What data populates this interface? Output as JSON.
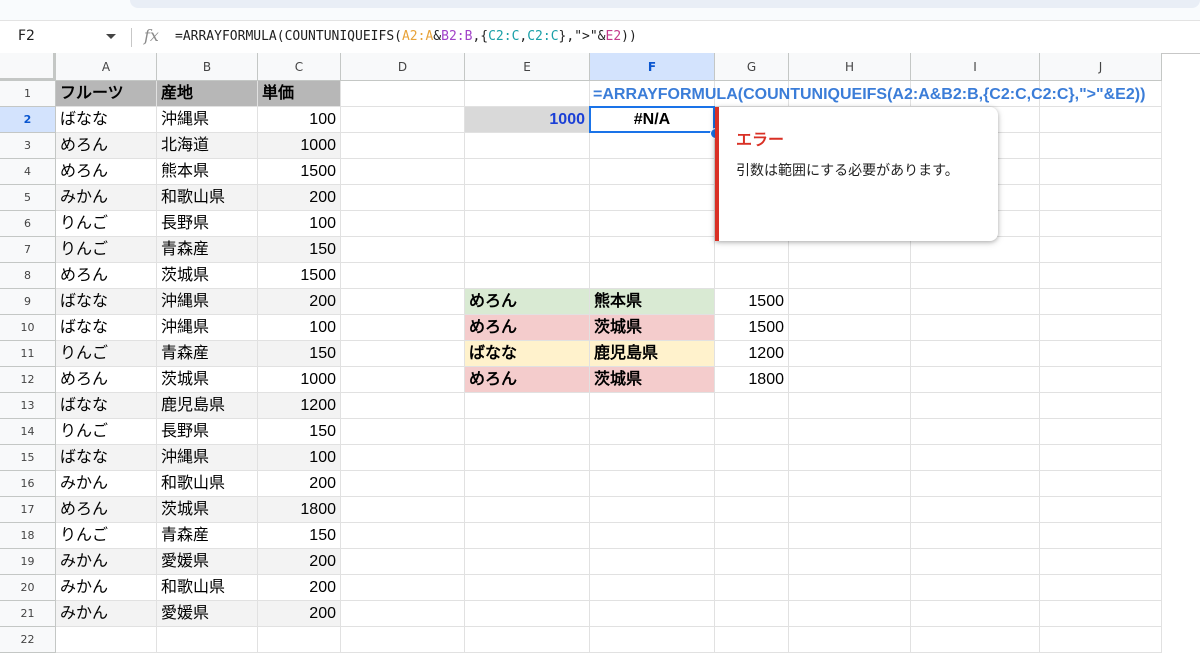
{
  "formula_bar": {
    "name_box": "F2",
    "fx": "fx",
    "formula_parts": [
      "=ARRAYFORMULA(COUNTUNIQUEIFS(",
      "A2:A",
      "&",
      "B2:B",
      ",{",
      "C2:C",
      ",",
      "C2:C",
      "},\">\"&",
      "E2",
      "))"
    ]
  },
  "columns": [
    "A",
    "B",
    "C",
    "D",
    "E",
    "F",
    "G",
    "H",
    "I",
    "J"
  ],
  "rows": [
    "1",
    "2",
    "3",
    "4",
    "5",
    "6",
    "7",
    "8",
    "9",
    "10",
    "11",
    "12",
    "13",
    "14",
    "15",
    "16",
    "17",
    "18",
    "19",
    "20",
    "21",
    "22"
  ],
  "selected_cell": {
    "column": "F",
    "row": "2"
  },
  "table": {
    "headers": [
      "フルーツ",
      "産地",
      "単価"
    ],
    "rows": [
      [
        "ばなな",
        "沖縄県",
        "100"
      ],
      [
        "めろん",
        "北海道",
        "1000"
      ],
      [
        "めろん",
        "熊本県",
        "1500"
      ],
      [
        "みかん",
        "和歌山県",
        "200"
      ],
      [
        "りんご",
        "長野県",
        "100"
      ],
      [
        "りんご",
        "青森産",
        "150"
      ],
      [
        "めろん",
        "茨城県",
        "1500"
      ],
      [
        "ばなな",
        "沖縄県",
        "200"
      ],
      [
        "ばなな",
        "沖縄県",
        "100"
      ],
      [
        "りんご",
        "青森産",
        "150"
      ],
      [
        "めろん",
        "茨城県",
        "1000"
      ],
      [
        "ばなな",
        "鹿児島県",
        "1200"
      ],
      [
        "りんご",
        "長野県",
        "150"
      ],
      [
        "ばなな",
        "沖縄県",
        "100"
      ],
      [
        "みかん",
        "和歌山県",
        "200"
      ],
      [
        "めろん",
        "茨城県",
        "1800"
      ],
      [
        "りんご",
        "青森産",
        "150"
      ],
      [
        "みかん",
        "愛媛県",
        "200"
      ],
      [
        "みかん",
        "和歌山県",
        "200"
      ],
      [
        "みかん",
        "愛媛県",
        "200"
      ]
    ]
  },
  "f1_formula_text": "=ARRAYFORMULA(COUNTUNIQUEIFS(A2:A&B2:B,{C2:C,C2:C},\">\"&E2))",
  "e2_value": "1000",
  "f2_value": "#N/A",
  "highlight": {
    "rows": [
      {
        "fruit": "めろん",
        "origin": "熊本県",
        "price": "1500",
        "color": "green"
      },
      {
        "fruit": "めろん",
        "origin": "茨城県",
        "price": "1500",
        "color": "red"
      },
      {
        "fruit": "ばなな",
        "origin": "鹿児島県",
        "price": "1200",
        "color": "yellow"
      },
      {
        "fruit": "めろん",
        "origin": "茨城県",
        "price": "1800",
        "color": "red"
      }
    ]
  },
  "error_card": {
    "title": "エラー",
    "message": "引数は範囲にする必要があります。"
  },
  "colors": {
    "selection": "#1a73e8",
    "header_fill": "#b7b7b7",
    "green": "#d9ead3",
    "red": "#f4cccc",
    "yellow": "#fff2cc",
    "error": "#d93025"
  }
}
